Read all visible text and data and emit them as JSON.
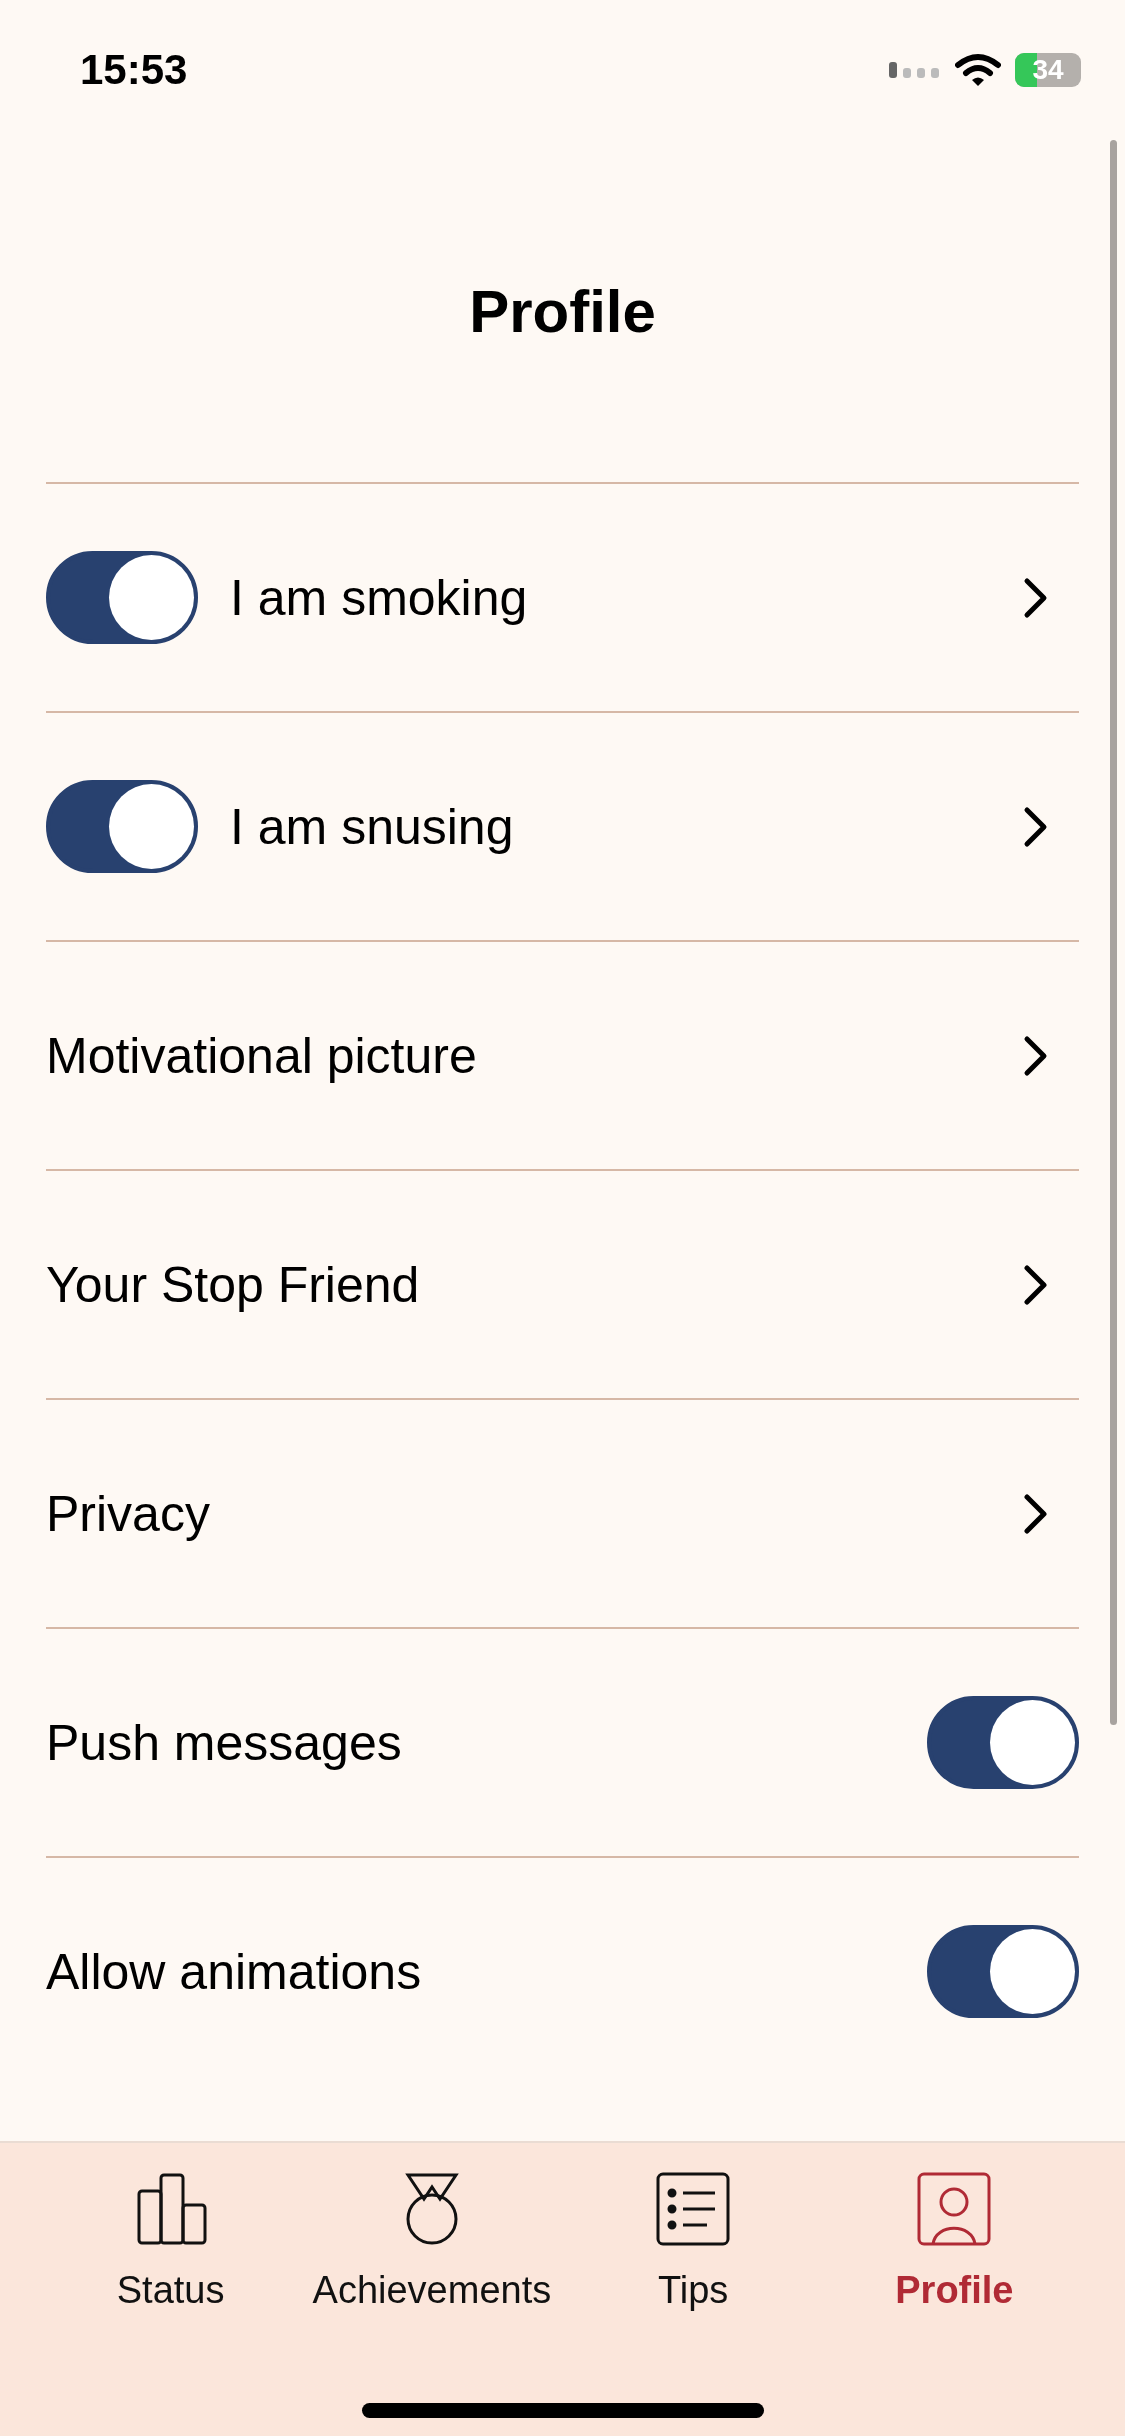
{
  "status_bar": {
    "time": "15:53",
    "battery": "34"
  },
  "title": "Profile",
  "rows": [
    {
      "kind": "toggle-link",
      "label": "I am smoking",
      "on": true
    },
    {
      "kind": "toggle-link",
      "label": "I am snusing",
      "on": true
    },
    {
      "kind": "link",
      "label": "Motivational picture"
    },
    {
      "kind": "link",
      "label": "Your Stop Friend"
    },
    {
      "kind": "link",
      "label": "Privacy"
    },
    {
      "kind": "toggle",
      "label": "Push messages",
      "on": true
    },
    {
      "kind": "toggle",
      "label": "Allow animations",
      "on": true
    }
  ],
  "tabs": [
    {
      "kind": "status",
      "label": "Status",
      "selected": false
    },
    {
      "kind": "achievements",
      "label": "Achievements",
      "selected": false
    },
    {
      "kind": "tips",
      "label": "Tips",
      "selected": false
    },
    {
      "kind": "profile",
      "label": "Profile",
      "selected": true
    }
  ]
}
